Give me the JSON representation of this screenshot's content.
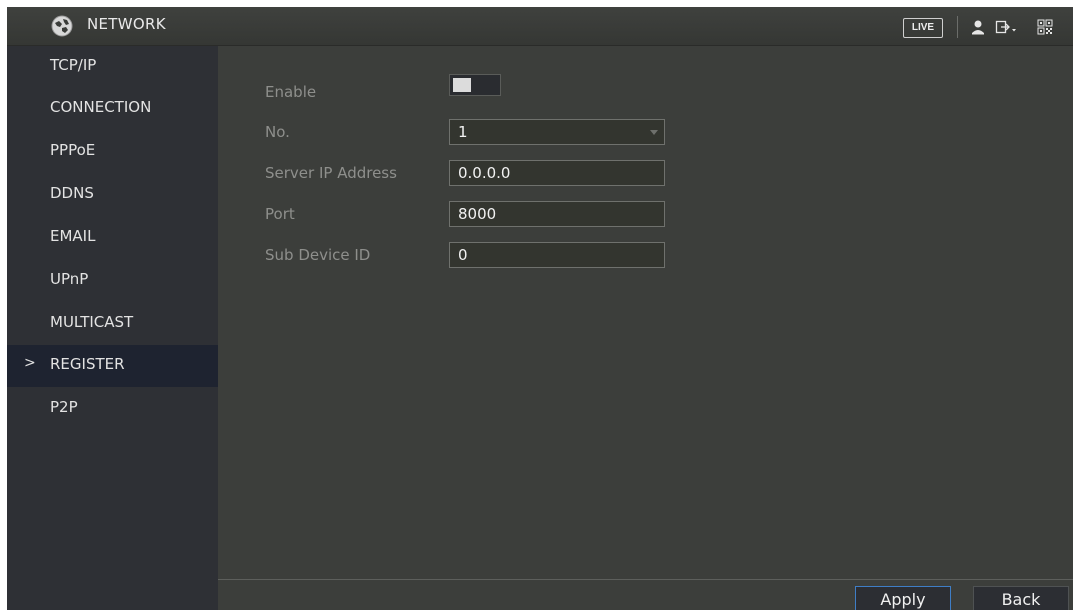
{
  "header": {
    "title": "NETWORK",
    "live_label": "LIVE",
    "icons": [
      "network-globe-icon",
      "user-icon",
      "logout-icon",
      "qrcode-icon"
    ]
  },
  "sidebar": {
    "items": [
      {
        "label": "TCP/IP",
        "active": false
      },
      {
        "label": "CONNECTION",
        "active": false
      },
      {
        "label": "PPPoE",
        "active": false
      },
      {
        "label": "DDNS",
        "active": false
      },
      {
        "label": "EMAIL",
        "active": false
      },
      {
        "label": "UPnP",
        "active": false
      },
      {
        "label": "MULTICAST",
        "active": false
      },
      {
        "label": "REGISTER",
        "active": true
      },
      {
        "label": "P2P",
        "active": false
      }
    ],
    "active_marker": ">"
  },
  "form": {
    "enable_label": "Enable",
    "enable_value": false,
    "no_label": "No.",
    "no_value": "1",
    "server_ip_label": "Server IP Address",
    "server_ip_value": "0.0.0.0",
    "port_label": "Port",
    "port_value": "8000",
    "sub_device_label": "Sub Device ID",
    "sub_device_value": "0"
  },
  "footer": {
    "apply_label": "Apply",
    "back_label": "Back"
  },
  "colors": {
    "background": "#3c3e3b",
    "sidebar": "#2e3035",
    "sidebar_active": "#1e2330",
    "accent_border": "#3f7ec6"
  }
}
